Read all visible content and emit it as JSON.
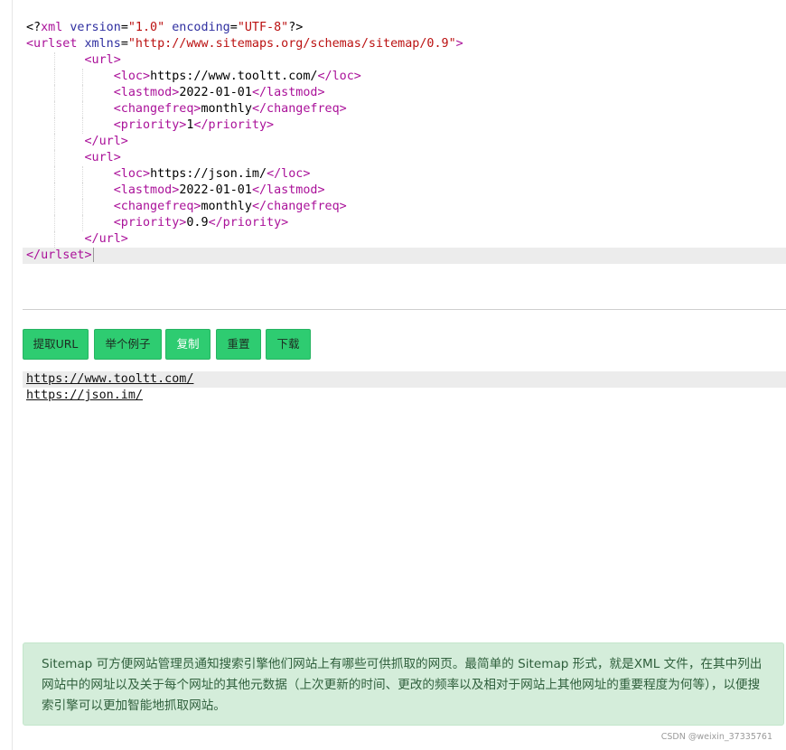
{
  "editor": {
    "lines": [
      [
        {
          "t": "<?",
          "c": "tok-text"
        },
        {
          "t": "xml",
          "c": "tok-tag"
        },
        {
          "t": " ",
          "c": "tok-text"
        },
        {
          "t": "version",
          "c": "tok-attr"
        },
        {
          "t": "=",
          "c": "tok-text"
        },
        {
          "t": "\"1.0\"",
          "c": "tok-str"
        },
        {
          "t": " ",
          "c": "tok-text"
        },
        {
          "t": "encoding",
          "c": "tok-attr"
        },
        {
          "t": "=",
          "c": "tok-text"
        },
        {
          "t": "\"UTF-8\"",
          "c": "tok-str"
        },
        {
          "t": "?>",
          "c": "tok-text"
        }
      ],
      [
        {
          "t": "<urlset",
          "c": "tok-tag"
        },
        {
          "t": " ",
          "c": "tok-text"
        },
        {
          "t": "xmlns",
          "c": "tok-attr"
        },
        {
          "t": "=",
          "c": "tok-text"
        },
        {
          "t": "\"http://www.sitemaps.org/schemas/sitemap/0.9\"",
          "c": "tok-str"
        },
        {
          "t": ">",
          "c": "tok-tag"
        }
      ],
      [
        {
          "t": "        ",
          "c": "tok-text"
        },
        {
          "t": "<url>",
          "c": "tok-tag"
        }
      ],
      [
        {
          "t": "            ",
          "c": "tok-text"
        },
        {
          "t": "<loc>",
          "c": "tok-tag"
        },
        {
          "t": "https://www.tooltt.com/",
          "c": "tok-text"
        },
        {
          "t": "</loc>",
          "c": "tok-tag"
        }
      ],
      [
        {
          "t": "            ",
          "c": "tok-text"
        },
        {
          "t": "<lastmod>",
          "c": "tok-tag"
        },
        {
          "t": "2022-01-01",
          "c": "tok-text"
        },
        {
          "t": "</lastmod>",
          "c": "tok-tag"
        }
      ],
      [
        {
          "t": "            ",
          "c": "tok-text"
        },
        {
          "t": "<changefreq>",
          "c": "tok-tag"
        },
        {
          "t": "monthly",
          "c": "tok-text"
        },
        {
          "t": "</changefreq>",
          "c": "tok-tag"
        }
      ],
      [
        {
          "t": "            ",
          "c": "tok-text"
        },
        {
          "t": "<priority>",
          "c": "tok-tag"
        },
        {
          "t": "1",
          "c": "tok-text"
        },
        {
          "t": "</priority>",
          "c": "tok-tag"
        }
      ],
      [
        {
          "t": "        ",
          "c": "tok-text"
        },
        {
          "t": "</url>",
          "c": "tok-tag"
        }
      ],
      [
        {
          "t": "        ",
          "c": "tok-text"
        },
        {
          "t": "<url>",
          "c": "tok-tag"
        }
      ],
      [
        {
          "t": "            ",
          "c": "tok-text"
        },
        {
          "t": "<loc>",
          "c": "tok-tag"
        },
        {
          "t": "https://json.im/",
          "c": "tok-text"
        },
        {
          "t": "</loc>",
          "c": "tok-tag"
        }
      ],
      [
        {
          "t": "            ",
          "c": "tok-text"
        },
        {
          "t": "<lastmod>",
          "c": "tok-tag"
        },
        {
          "t": "2022-01-01",
          "c": "tok-text"
        },
        {
          "t": "</lastmod>",
          "c": "tok-tag"
        }
      ],
      [
        {
          "t": "            ",
          "c": "tok-text"
        },
        {
          "t": "<changefreq>",
          "c": "tok-tag"
        },
        {
          "t": "monthly",
          "c": "tok-text"
        },
        {
          "t": "</changefreq>",
          "c": "tok-tag"
        }
      ],
      [
        {
          "t": "            ",
          "c": "tok-text"
        },
        {
          "t": "<priority>",
          "c": "tok-tag"
        },
        {
          "t": "0.9",
          "c": "tok-text"
        },
        {
          "t": "</priority>",
          "c": "tok-tag"
        }
      ],
      [
        {
          "t": "        ",
          "c": "tok-text"
        },
        {
          "t": "</url>",
          "c": "tok-tag"
        }
      ],
      [
        {
          "t": "</urlset>",
          "c": "tok-tag"
        }
      ]
    ]
  },
  "toolbar": {
    "extract_label": "提取URL",
    "example_label": "举个例子",
    "copy_label": "复制",
    "reset_label": "重置",
    "download_label": "下载"
  },
  "results": {
    "urls": [
      "https://www.tooltt.com/",
      "https://json.im/"
    ]
  },
  "info": {
    "text": "Sitemap 可方便网站管理员通知搜索引擎他们网站上有哪些可供抓取的网页。最简单的 Sitemap 形式，就是XML 文件，在其中列出网站中的网址以及关于每个网址的其他元数据（上次更新的时间、更改的频率以及相对于网站上其他网址的重要程度为何等），以便搜索引擎可以更加智能地抓取网站。"
  },
  "watermark": "CSDN @weixin_37335761",
  "colors": {
    "button_green": "#2ecc71",
    "alert_background": "#d4edda",
    "xml_tag": "#aa1199",
    "xml_string": "#bb1111"
  }
}
